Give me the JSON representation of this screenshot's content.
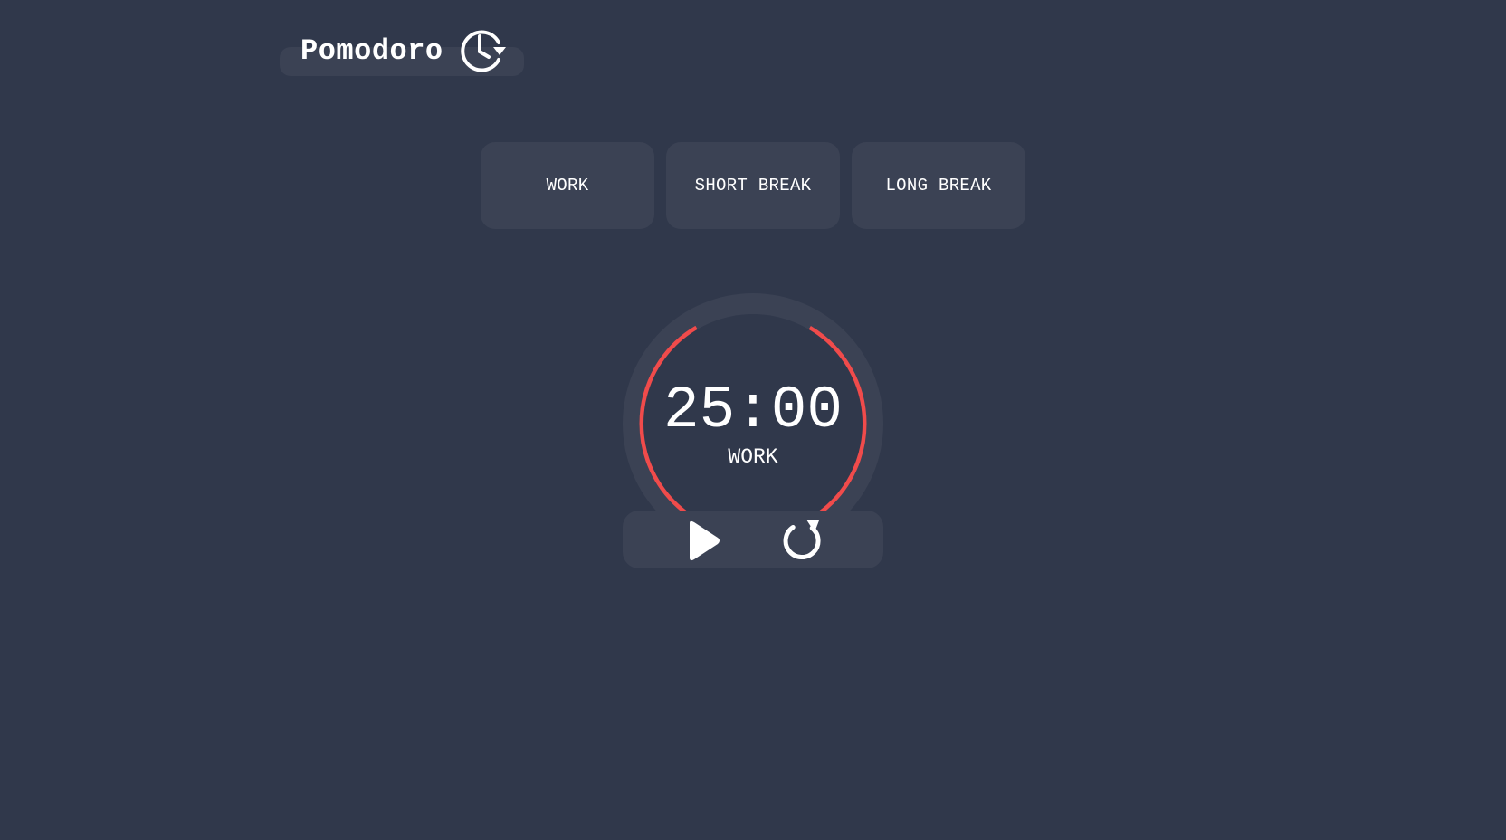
{
  "header": {
    "title": "Pomodoro",
    "icon": "clock-history-icon"
  },
  "modes": [
    {
      "label": "WORK"
    },
    {
      "label": "SHORT BREAK"
    },
    {
      "label": "LONG BREAK"
    }
  ],
  "timer": {
    "time": "25:00",
    "session_label": "WORK",
    "progress_fraction": 0.83
  },
  "controls": {
    "play_icon": "play-icon",
    "reset_icon": "reset-icon"
  },
  "colors": {
    "background": "#30384b",
    "surface": "#3b4254",
    "accent": "#f04b4b",
    "text": "#ffffff"
  }
}
